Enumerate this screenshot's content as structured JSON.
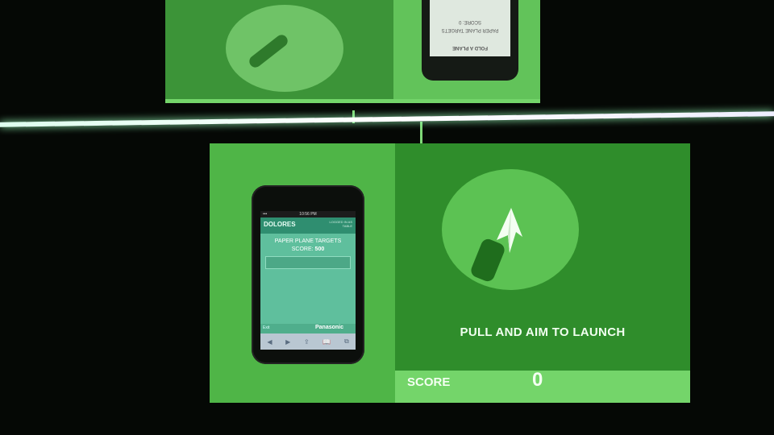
{
  "upper": {
    "phone": {
      "title": "FOLD A PLANE",
      "line1": "PAPER PLANE TARGETS",
      "line2": "SCORE: 0"
    }
  },
  "phone": {
    "status": {
      "carrier": "•••",
      "time": "10:56 PM"
    },
    "header": {
      "user": "DOLORES",
      "logged": "LOGGED IN AS TABLE"
    },
    "title": "PAPER PLANE TARGETS",
    "score_label": "SCORE:",
    "score_value": "500",
    "footer_left": "Exit",
    "brand": "Panasonic",
    "browser": {
      "back": "◀",
      "forward": "▶",
      "share": "⇪",
      "bookmarks": "📖",
      "tabs": "⧉"
    }
  },
  "game": {
    "instruction": "PULL AND AIM TO LAUNCH",
    "score_label": "SCORE",
    "score_value": "0"
  },
  "colors": {
    "screen_green": "#2d8a2a",
    "panel_light": "#4fb547",
    "accent_bar": "#74d56a",
    "phone_app": "#5fbf9d"
  },
  "icons": [
    "paper-plane-icon",
    "slingshot-icon"
  ]
}
